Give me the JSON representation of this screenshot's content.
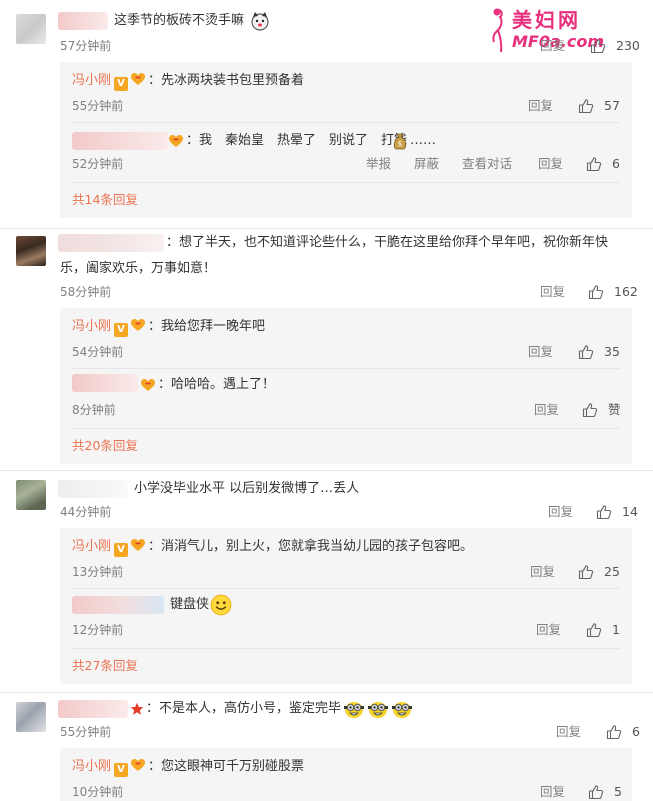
{
  "watermark": {
    "title": "美妇网",
    "domain": "MF0a.com"
  },
  "comments": [
    {
      "text": "这季节的板砖不烫手嘛",
      "time": "57分钟前",
      "reply": "回复",
      "likes": "230",
      "replies": [
        {
          "user": "冯小刚",
          "text": "：先冰两块装书包里预备着",
          "time": "55分钟前",
          "reply": "回复",
          "likes": "57"
        },
        {
          "text": "：我　秦始皇　热晕了　别说了　打钱",
          "tail": "……",
          "time": "52分钟前",
          "actions": [
            "举报",
            "屏蔽",
            "查看对话",
            "回复"
          ],
          "likes": "6"
        }
      ],
      "more": "共14条回复"
    },
    {
      "text1": "：想了半天，也不知道评论些什么，干脆在这里给你拜个早年吧，祝你新年快",
      "text2": "乐，阖家欢乐，万事如意！",
      "time": "58分钟前",
      "reply": "回复",
      "likes": "162",
      "replies": [
        {
          "user": "冯小刚",
          "text": "：我给您拜一晚年吧",
          "time": "54分钟前",
          "reply": "回复",
          "likes": "35"
        },
        {
          "text": "：哈哈哈。遇上了！",
          "time": "8分钟前",
          "reply": "回复",
          "likes": "赞"
        }
      ],
      "more": "共20条回复"
    },
    {
      "text": "小学没毕业水平 以后别发微博了…丢人",
      "time": "44分钟前",
      "reply": "回复",
      "likes": "14",
      "replies": [
        {
          "user": "冯小刚",
          "text": "：消消气儿，别上火，您就拿我当幼儿园的孩子包容吧。",
          "time": "13分钟前",
          "reply": "回复",
          "likes": "25"
        },
        {
          "text": "键盘侠",
          "time": "12分钟前",
          "reply": "回复",
          "likes": "1"
        }
      ],
      "more": "共27条回复"
    },
    {
      "text": "：不是本人，高仿小号，鉴定完毕",
      "time": "55分钟前",
      "reply": "回复",
      "likes": "6",
      "replies": [
        {
          "user": "冯小刚",
          "text": "：您这眼神可千万别碰股票",
          "time": "10分钟前",
          "reply": "回复",
          "likes": "5"
        }
      ]
    }
  ],
  "colors": {
    "username": "#eb7350",
    "meta": "#808080",
    "subpanel": "#f5f5f5"
  }
}
